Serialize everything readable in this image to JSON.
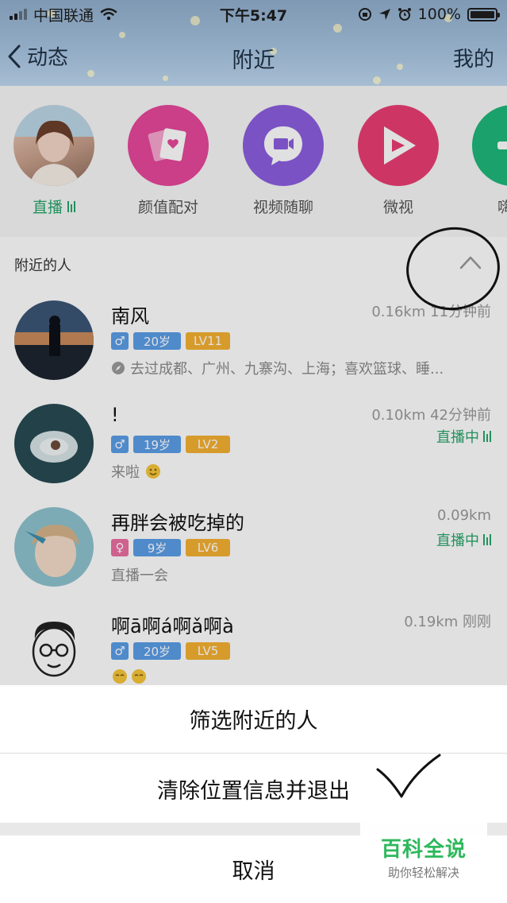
{
  "status_bar": {
    "carrier": "中国联通",
    "time": "下午5:47",
    "battery": "100%"
  },
  "nav": {
    "back_label": "动态",
    "title": "附近",
    "right_label": "我的"
  },
  "entries": [
    {
      "label": "直播",
      "icon": "live-avatar",
      "color": "#d9b6a4"
    },
    {
      "label": "颜值配对",
      "icon": "cards-heart-icon",
      "color": "#e8479b"
    },
    {
      "label": "视频随聊",
      "icon": "video-chat-icon",
      "color": "#8b5ee0"
    },
    {
      "label": "微视",
      "icon": "play-icon",
      "color": "#ea3e72"
    },
    {
      "label": "嗨玩",
      "icon": "game-icon",
      "color": "#1fb87a"
    }
  ],
  "nearby": {
    "section_title": "附近的人",
    "people": [
      {
        "name": "南风",
        "gender": "male",
        "age": "20岁",
        "level": "LV11",
        "meta": "0.16km 11分钟前",
        "live": "",
        "desc": "去过成都、广州、九寨沟、上海；喜欢篮球、睡..."
      },
      {
        "name": "!",
        "gender": "male",
        "age": "19岁",
        "level": "LV2",
        "meta": "0.10km 42分钟前",
        "live": "直播中",
        "desc": "来啦"
      },
      {
        "name": "再胖会被吃掉的",
        "gender": "female",
        "age": "9岁",
        "level": "LV6",
        "meta": "0.09km",
        "live": "直播中",
        "desc": "直播一会"
      },
      {
        "name": "啊ā啊á啊ǎ啊à",
        "gender": "male",
        "age": "20岁",
        "level": "LV5",
        "meta": "0.19km 刚刚",
        "live": "",
        "desc": ""
      }
    ]
  },
  "sheet": {
    "filter": "筛选附近的人",
    "clear": "清除位置信息并退出",
    "cancel": "取消"
  },
  "watermark": {
    "title": "百科全说",
    "subtitle": "助你轻松解决"
  }
}
